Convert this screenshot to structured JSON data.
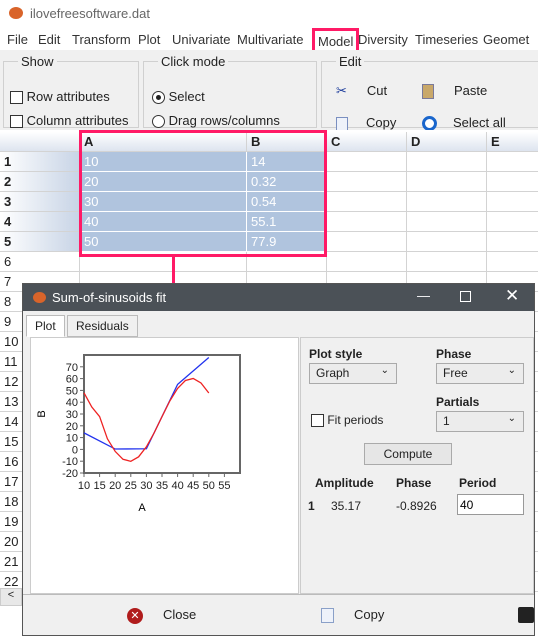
{
  "window": {
    "title": "ilovefreesoftware.dat"
  },
  "menu": [
    "File",
    "Edit",
    "Transform",
    "Plot",
    "Univariate",
    "Multivariate",
    "Model",
    "Diversity",
    "Timeseries",
    "Geomet"
  ],
  "highlight_color": "#ff1a66",
  "toolbar": {
    "show": {
      "title": "Show",
      "row_attributes": "Row attributes",
      "column_attributes": "Column attributes"
    },
    "click_mode": {
      "title": "Click mode",
      "select": "Select",
      "drag": "Drag rows/columns",
      "selected": "Select"
    },
    "edit": {
      "title": "Edit",
      "cut": "Cut",
      "paste": "Paste",
      "copy": "Copy",
      "select_all": "Select all"
    }
  },
  "grid": {
    "columns": [
      "A",
      "B",
      "C",
      "D",
      "E"
    ],
    "row_numbers": [
      "1",
      "2",
      "3",
      "4",
      "5",
      "6",
      "7",
      "8",
      "9",
      "10",
      "11",
      "12",
      "13",
      "14",
      "15",
      "16",
      "17",
      "18",
      "19",
      "20",
      "21",
      "22"
    ],
    "rows": [
      [
        "10",
        "14"
      ],
      [
        "20",
        "0.32"
      ],
      [
        "30",
        "0.54"
      ],
      [
        "40",
        "55.1"
      ],
      [
        "50",
        "77.9"
      ]
    ]
  },
  "dialog": {
    "title": "Sum-of-sinusoids fit",
    "tabs": [
      "Plot",
      "Residuals"
    ],
    "plot_style_label": "Plot style",
    "plot_style_value": "Graph",
    "phase_label": "Phase",
    "phase_value": "Free",
    "partials_label": "Partials",
    "partials_value": "1",
    "fit_periods": "Fit periods",
    "compute": "Compute",
    "results_headers": [
      "Amplitude",
      "Phase",
      "Period"
    ],
    "results": [
      {
        "index": "1",
        "amplitude": "35.17",
        "phase": "-0.8926",
        "period": "40"
      }
    ],
    "close": "Close",
    "copy": "Copy"
  },
  "chart_data": {
    "type": "line",
    "xlabel": "A",
    "ylabel": "B",
    "xlim": [
      10,
      60
    ],
    "ylim": [
      -20,
      80
    ],
    "xticks": [
      "10",
      "15",
      "20",
      "25",
      "30",
      "35",
      "40",
      "45",
      "50",
      "55"
    ],
    "yticks": [
      "-20",
      "-10",
      "0",
      "10",
      "20",
      "30",
      "40",
      "50",
      "60",
      "70"
    ],
    "series": [
      {
        "color": "#2233ee",
        "x": [
          10,
          20,
          30,
          40,
          50
        ],
        "y": [
          14,
          0.32,
          0.54,
          55.1,
          77.9
        ]
      },
      {
        "color": "#ee2222",
        "x": [
          10,
          12.5,
          15,
          17.5,
          20,
          22.5,
          25,
          27.5,
          30,
          32.5,
          35,
          37.5,
          40,
          42.5,
          45,
          47.5,
          50
        ],
        "y": [
          48,
          35.9,
          27.8,
          9,
          -1.7,
          -8.4,
          -10.1,
          -6.3,
          2.2,
          14.1,
          27.8,
          41,
          51.7,
          58.4,
          60.1,
          56.3,
          47.8
        ]
      }
    ]
  }
}
